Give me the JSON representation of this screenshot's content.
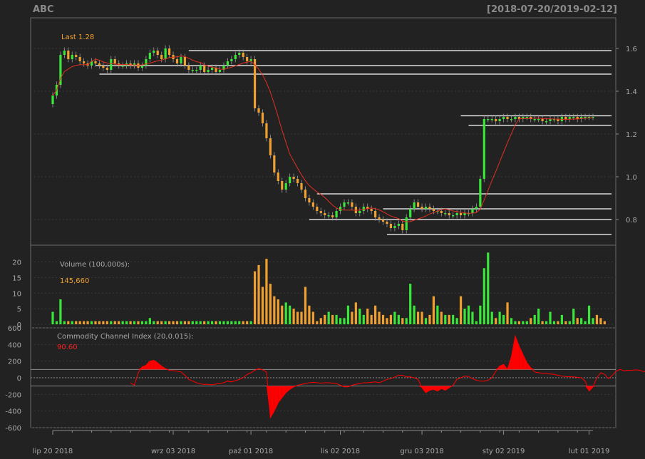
{
  "header": {
    "symbol": "ABC",
    "date_range": "[2018-07-20/2019-02-12]"
  },
  "colors": {
    "background": "#222222",
    "up_candle": "#39e639",
    "down_candle": "#f0a030",
    "sma_line": "#e03020",
    "cci_fill": "#ff0000",
    "level_lines": "#ffffff",
    "last_label": "#f0a030"
  },
  "chart_data": [
    {
      "type": "candlestick",
      "title": "",
      "last_label": "Last 1.28",
      "ylim": [
        0.7,
        1.7
      ],
      "yticks": [
        0.8,
        1.0,
        1.2,
        1.4,
        1.6
      ],
      "ytick_labels": [
        "0.8",
        "1.0",
        "1.2",
        "1.4",
        "1.6"
      ],
      "x_dates": [
        "lip 20 2018",
        "wrz 03 2018",
        "paź 01 2018",
        "lis 02 2018",
        "gru 03 2018",
        "sty 02 2019",
        "lut 01 2019"
      ],
      "xtick_index": [
        0,
        31,
        51,
        74,
        95,
        116,
        138
      ],
      "n_sessions": 140,
      "ohlc_close": [
        1.38,
        1.43,
        1.57,
        1.59,
        1.55,
        1.57,
        1.56,
        1.54,
        1.53,
        1.52,
        1.54,
        1.53,
        1.52,
        1.51,
        1.5,
        1.55,
        1.53,
        1.52,
        1.52,
        1.53,
        1.52,
        1.53,
        1.51,
        1.52,
        1.55,
        1.58,
        1.59,
        1.57,
        1.55,
        1.6,
        1.57,
        1.55,
        1.53,
        1.56,
        1.52,
        1.5,
        1.5,
        1.5,
        1.52,
        1.49,
        1.5,
        1.51,
        1.49,
        1.5,
        1.52,
        1.54,
        1.55,
        1.57,
        1.58,
        1.56,
        1.54,
        1.55,
        1.32,
        1.3,
        1.25,
        1.18,
        1.1,
        1.02,
        0.98,
        0.94,
        0.97,
        1.0,
        0.99,
        0.97,
        0.94,
        0.9,
        0.88,
        0.86,
        0.84,
        0.83,
        0.82,
        0.82,
        0.81,
        0.84,
        0.86,
        0.88,
        0.88,
        0.86,
        0.83,
        0.84,
        0.86,
        0.85,
        0.84,
        0.81,
        0.8,
        0.79,
        0.78,
        0.76,
        0.77,
        0.78,
        0.75,
        0.81,
        0.85,
        0.88,
        0.86,
        0.85,
        0.86,
        0.85,
        0.84,
        0.84,
        0.83,
        0.83,
        0.82,
        0.82,
        0.83,
        0.82,
        0.83,
        0.83,
        0.85,
        0.86,
        0.99,
        1.27,
        1.27,
        1.27,
        1.26,
        1.27,
        1.28,
        1.27,
        1.27,
        1.28,
        1.27,
        1.28,
        1.28,
        1.27,
        1.27,
        1.27,
        1.26,
        1.26,
        1.27,
        1.27,
        1.26,
        1.28,
        1.27,
        1.28,
        1.28,
        1.27,
        1.28,
        1.28,
        1.28,
        1.28
      ],
      "sma_label": "",
      "price_levels": [
        {
          "y": 1.59,
          "from_index": 35
        },
        {
          "y": 1.52,
          "from_index": 11
        },
        {
          "y": 1.48,
          "from_index": 12
        },
        {
          "y": 0.92,
          "from_index": 68
        },
        {
          "y": 0.85,
          "from_index": 85
        },
        {
          "y": 0.8,
          "from_index": 66
        },
        {
          "y": 0.73,
          "from_index": 86
        },
        {
          "y": 1.285,
          "from_index": 105
        },
        {
          "y": 1.24,
          "from_index": 107
        }
      ]
    },
    {
      "type": "bar",
      "title": "Volume (100,000s):",
      "last_value": "145,660",
      "ylim": [
        0,
        24
      ],
      "yticks": [
        0,
        5,
        10,
        15,
        20
      ],
      "ytick_labels": [
        "0",
        "5",
        "10",
        "15",
        "20"
      ],
      "values": [
        4,
        1,
        8,
        1,
        1,
        1,
        1,
        1,
        1,
        1,
        1,
        1,
        1,
        1,
        1,
        1,
        1,
        1,
        1,
        1,
        1,
        1,
        1,
        1,
        1,
        2,
        1,
        1,
        1,
        1,
        1,
        1,
        1,
        1,
        1,
        1,
        1,
        1,
        1,
        1,
        1,
        1,
        1,
        1,
        1,
        1,
        1,
        1,
        1,
        1,
        1,
        1,
        17,
        19,
        12,
        21,
        13,
        9,
        8,
        6,
        7,
        6,
        5,
        4,
        4,
        12,
        6,
        4,
        1,
        2,
        3,
        4,
        3,
        3,
        2,
        2,
        6,
        4,
        7,
        5,
        3,
        5,
        3,
        6,
        4,
        3,
        2,
        3,
        4,
        3,
        2,
        2,
        13,
        6,
        4,
        4,
        2,
        3,
        9,
        6,
        4,
        3,
        3,
        3,
        2,
        9,
        5,
        6,
        4,
        1,
        6,
        18,
        23,
        4,
        2,
        4,
        3,
        7,
        2,
        1,
        1,
        1,
        1,
        2,
        3,
        5,
        1,
        1,
        4,
        1,
        1,
        3,
        1,
        1,
        5,
        2,
        2,
        1,
        6,
        2,
        3,
        2,
        1
      ]
    },
    {
      "type": "area",
      "title": "Commodity Channel Index (20,0.015):",
      "last_value": "90.60",
      "ylim": [
        -600,
        600
      ],
      "yticks": [
        -600,
        -400,
        -200,
        0,
        200,
        400,
        600
      ],
      "ytick_labels": [
        "-600",
        "-400",
        "-200",
        "0",
        "200",
        "400",
        "600"
      ],
      "bands": [
        100,
        -100
      ],
      "values": [
        -60,
        -90,
        60,
        130,
        150,
        200,
        210,
        180,
        140,
        110,
        90,
        85,
        80,
        70,
        30,
        -20,
        -40,
        -60,
        -75,
        -80,
        -80,
        -85,
        -75,
        -70,
        -60,
        -40,
        -50,
        -35,
        -20,
        0,
        40,
        60,
        90,
        110,
        95,
        70,
        -480,
        -400,
        -300,
        -240,
        -180,
        -140,
        -110,
        -90,
        -80,
        -70,
        -60,
        -55,
        -60,
        -65,
        -60,
        -60,
        -65,
        -70,
        -90,
        -110,
        -110,
        -90,
        -80,
        -70,
        -60,
        -60,
        -55,
        -50,
        -60,
        -40,
        -20,
        -10,
        10,
        30,
        30,
        10,
        10,
        0,
        -20,
        -120,
        -180,
        -150,
        -140,
        -160,
        -130,
        -150,
        -120,
        -90,
        -20,
        0,
        20,
        15,
        -10,
        -30,
        -40,
        -40,
        -30,
        0,
        80,
        140,
        160,
        100,
        250,
        500,
        380,
        280,
        180,
        120,
        70,
        60,
        55,
        50,
        45,
        40,
        30,
        20,
        15,
        10,
        10,
        5,
        0,
        -40,
        -160,
        -110,
        0,
        60,
        40,
        -10,
        30,
        80,
        100,
        85,
        90,
        90,
        95,
        90,
        75,
        80,
        95,
        90
      ]
    }
  ],
  "pane_text": {
    "volume_title": "Volume (100,000s):",
    "volume_last": "145,660",
    "cci_title": "Commodity Channel Index (20,0.015):",
    "cci_last": "90.60",
    "price_last": "Last 1.28"
  }
}
